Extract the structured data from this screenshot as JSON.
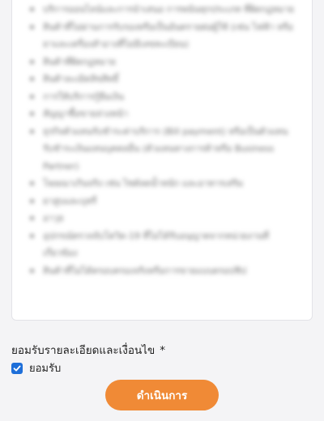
{
  "terms": {
    "items": [
      "บริการออนไลน์และการนำเสนอ การพนันทุกประเภท ที่ผิดกฎหมาย",
      "สินค้าที่ไม่ผ่านการรับรองหรือเป็นอันตรายต่อผู้ใช้ (เช่น ไฟฟ้า หรือ ยาและเครื่องสำอางที่ไม่มีเลขทะเบียน)",
      "สินค้าที่ผิดกฎหมาย",
      "สินค้าละเมิดลิขสิทธิ์",
      "การให้บริการกู้ยืมเงิน",
      "สัญญาซื้อขายล่วงหน้า",
      "ธุรกิจตัวแทนรับชำระค่าบริการ (Bill payment) หรือเป็นตัวแทนรับชำระเงินแทนบุคคลอื่น (ตัวแทนทางการค้าหรือ Business Partner)",
      "โฆษณาเกินจริง เช่น ไซต์ลดน้ำหนัก และอาหารเสริม",
      "ยาสูบและบุหรี่",
      "อาวุธ",
      "อุปกรณ์ตรวจจับโควิด-19 ที่ไม่ได้รับอนุญาตจากหน่วยงานที่เกี่ยวข้อง",
      "สินค้าที่ไม่ได้ครอบครองจริงหรือการขายแบบดรอปชิป"
    ]
  },
  "consent": {
    "label": "ยอมรับรายละเอียดและเงื่อนไข",
    "required_mark": "*",
    "checkbox_label": "ยอมรับ",
    "checked": true
  },
  "submit": {
    "label": "ดำเนินการ"
  },
  "colors": {
    "accent": "#f08a36",
    "checkbox": "#1e6fd9"
  }
}
